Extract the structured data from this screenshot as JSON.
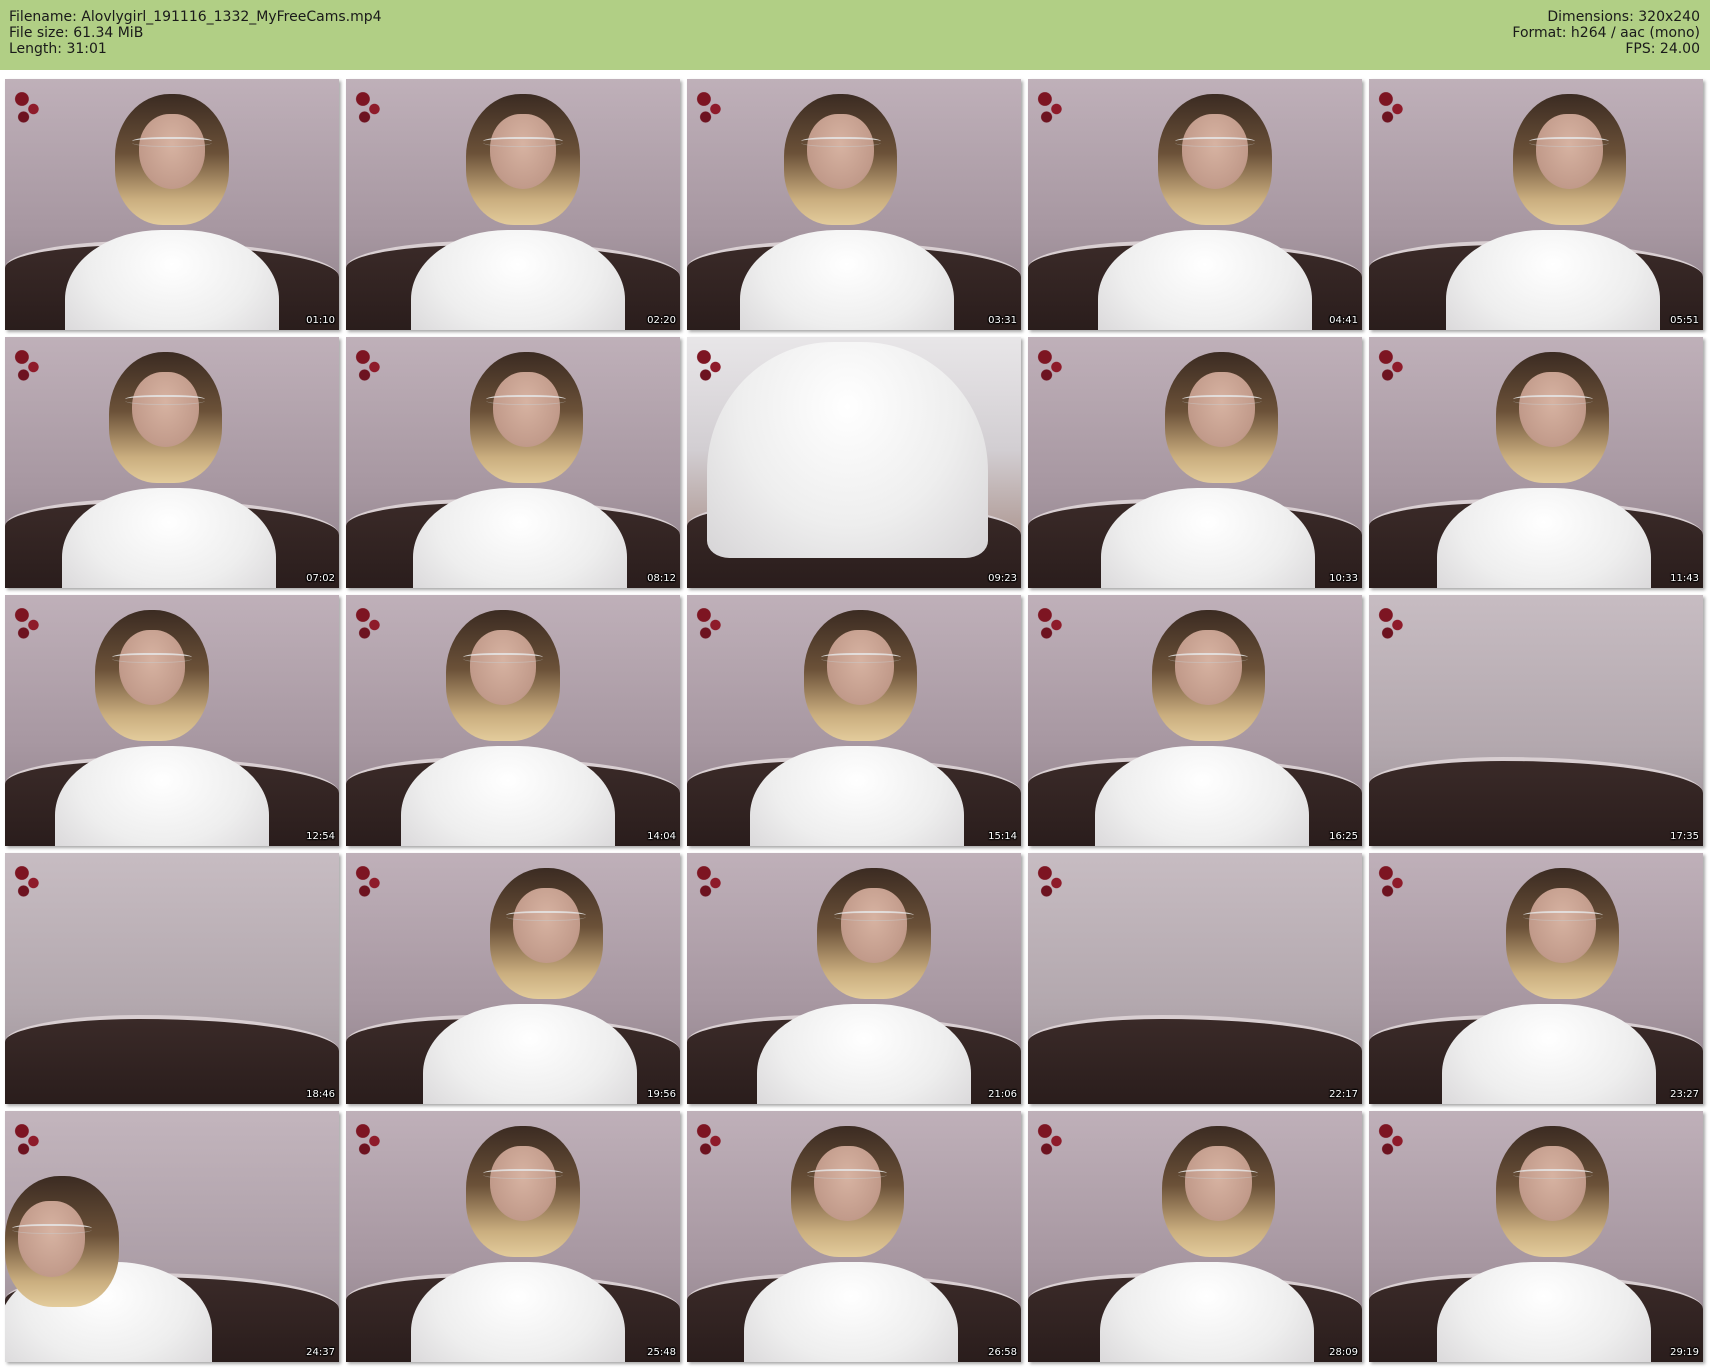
{
  "header": {
    "filename_line": "Filename: Alovlygirl_191116_1332_MyFreeCams.mp4",
    "filesize_line": "File size: 61.34 MiB",
    "length_line": "Length: 31:01",
    "dimensions_line": "Dimensions: 320x240",
    "format_line": "Format: h264 / aac (mono)",
    "fps_line": "FPS: 24.00"
  },
  "colors": {
    "header_bg": "#b1cf85",
    "page_bg": "#ffffff",
    "timestamp_text": "#ffffff"
  },
  "thumbnails": [
    {
      "timestamp": "01:10",
      "scene": "person-center"
    },
    {
      "timestamp": "02:20",
      "scene": "person-center"
    },
    {
      "timestamp": "03:31",
      "scene": "person-center"
    },
    {
      "timestamp": "04:41",
      "scene": "person-center"
    },
    {
      "timestamp": "05:51",
      "scene": "person-center"
    },
    {
      "timestamp": "07:02",
      "scene": "person-center"
    },
    {
      "timestamp": "08:12",
      "scene": "person-center"
    },
    {
      "timestamp": "09:23",
      "scene": "closeup-body"
    },
    {
      "timestamp": "10:33",
      "scene": "person-center"
    },
    {
      "timestamp": "11:43",
      "scene": "person-center"
    },
    {
      "timestamp": "12:54",
      "scene": "person-center"
    },
    {
      "timestamp": "14:04",
      "scene": "person-center"
    },
    {
      "timestamp": "15:14",
      "scene": "person-center"
    },
    {
      "timestamp": "16:25",
      "scene": "person-center"
    },
    {
      "timestamp": "17:35",
      "scene": "empty-room"
    },
    {
      "timestamp": "18:46",
      "scene": "empty-room"
    },
    {
      "timestamp": "19:56",
      "scene": "person-center"
    },
    {
      "timestamp": "21:06",
      "scene": "person-center"
    },
    {
      "timestamp": "22:17",
      "scene": "empty-room"
    },
    {
      "timestamp": "23:27",
      "scene": "person-center"
    },
    {
      "timestamp": "24:37",
      "scene": "person-left"
    },
    {
      "timestamp": "25:48",
      "scene": "person-center"
    },
    {
      "timestamp": "26:58",
      "scene": "person-center"
    },
    {
      "timestamp": "28:09",
      "scene": "person-center"
    },
    {
      "timestamp": "29:19",
      "scene": "person-center"
    }
  ]
}
